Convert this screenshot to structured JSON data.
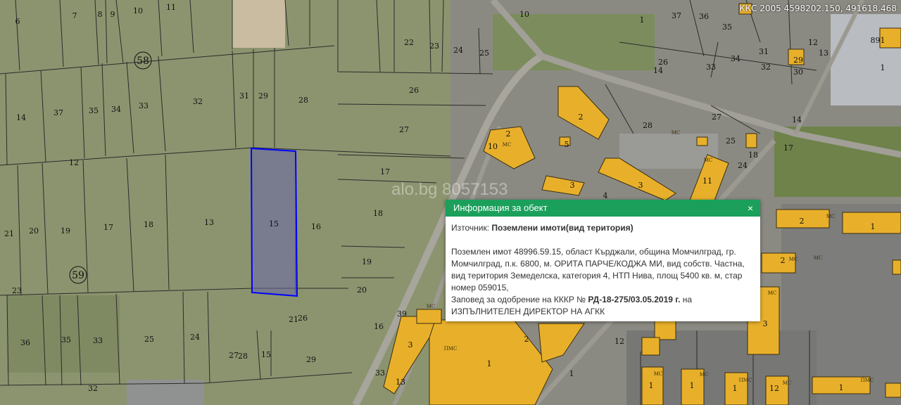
{
  "coordinates": "ККС 2005 4598202.150, 491618.468",
  "watermark": "alo.bg 8057153",
  "popup": {
    "title": "Информация за обект",
    "close_glyph": "×",
    "source_label": "Източник:",
    "source_value": "Поземлени имоти(вид територия)",
    "description": "Поземлен имот 48996.59.15, област Кърджали, община Момчилград, гр. Момчилград, п.к. 6800, м. ОРИТА ПАРЧЕ/КОДЖА МИ, вид собств. Частна, вид територия Земеделска, категория 4, НТП Нива, площ 5400 кв. м, стар номер 059015,",
    "order_prefix": "Заповед за одобрение на КККР №",
    "order_number": "РД-18-275/03.05.2019 г.",
    "order_suffix": "на",
    "order_issuer": "ИЗПЪЛНИТЕЛЕН ДИРЕКТОР НА АГКК"
  },
  "map": {
    "colors": {
      "building_fill": "#e8b02a",
      "selected_outline": "#0000ff",
      "parcel_line": "#2b2b2b",
      "header_green": "#1aa05b"
    },
    "selected_parcel_label": "15",
    "block_labels": [
      "58",
      "59"
    ],
    "parcel_labels": [
      "6",
      "7",
      "8",
      "9",
      "10",
      "11",
      "15",
      "16",
      "17",
      "18",
      "19",
      "20",
      "21",
      "22",
      "23",
      "24",
      "25",
      "26",
      "27",
      "28",
      "29",
      "31",
      "32",
      "33",
      "34",
      "35",
      "37",
      "14",
      "12",
      "13",
      "17",
      "18",
      "19",
      "20",
      "21",
      "23",
      "24",
      "25",
      "26",
      "27",
      "28",
      "29",
      "33",
      "35",
      "36",
      "16",
      "15",
      "32",
      "13",
      "39",
      "12",
      "1",
      "2",
      "3",
      "5",
      "4",
      "10",
      "11",
      "12",
      "13",
      "14",
      "17",
      "18",
      "24",
      "25",
      "26",
      "27",
      "28",
      "29",
      "30",
      "31",
      "32",
      "33",
      "34",
      "35",
      "36",
      "37",
      "1",
      "2",
      "3",
      "2",
      "3",
      "1",
      "1",
      "2",
      "3",
      "1",
      "2",
      "1",
      "891",
      "1",
      "1",
      "1",
      "1",
      "12",
      "14",
      "10",
      "33"
    ],
    "building_codes": [
      "МС",
      "МС",
      "МС",
      "МС",
      "ПМС",
      "МС",
      "МС",
      "ПМС",
      "МС",
      "МС",
      "МС",
      "МС",
      "ПМС",
      "МС"
    ]
  }
}
